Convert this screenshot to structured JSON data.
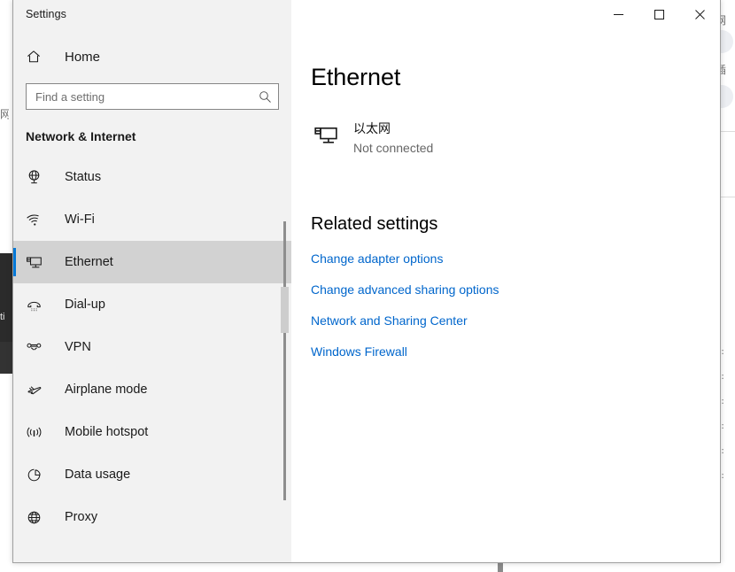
{
  "window": {
    "title": "Settings",
    "controls": {
      "minimize": "Minimize",
      "maximize": "Maximize",
      "close": "Close"
    }
  },
  "sidebar": {
    "home_label": "Home",
    "search": {
      "placeholder": "Find a setting",
      "value": "",
      "icon": "search-icon"
    },
    "category": "Network & Internet",
    "items": [
      {
        "label": "Status",
        "icon": "status-globe-icon",
        "selected": false
      },
      {
        "label": "Wi-Fi",
        "icon": "wifi-icon",
        "selected": false
      },
      {
        "label": "Ethernet",
        "icon": "ethernet-icon",
        "selected": true
      },
      {
        "label": "Dial-up",
        "icon": "dialup-phone-icon",
        "selected": false
      },
      {
        "label": "VPN",
        "icon": "vpn-icon",
        "selected": false
      },
      {
        "label": "Airplane mode",
        "icon": "airplane-icon",
        "selected": false
      },
      {
        "label": "Mobile hotspot",
        "icon": "hotspot-icon",
        "selected": false
      },
      {
        "label": "Data usage",
        "icon": "data-usage-pie-icon",
        "selected": false
      },
      {
        "label": "Proxy",
        "icon": "proxy-globe-icon",
        "selected": false
      }
    ]
  },
  "main": {
    "page_title": "Ethernet",
    "adapter": {
      "name": "以太网",
      "status": "Not connected",
      "icon": "ethernet-adapter-icon"
    },
    "related": {
      "title": "Related settings",
      "links": [
        "Change adapter options",
        "Change advanced sharing options",
        "Network and Sharing Center",
        "Windows Firewall"
      ]
    }
  },
  "background": {
    "taskbar_text": "ti",
    "edge_glyphs": [
      "网",
      "插"
    ],
    "edge_rows": [
      "h:",
      "h:",
      "h:",
      "h:",
      "h:",
      "h:"
    ]
  },
  "colors": {
    "accent": "#0078d7",
    "link": "#0066cc",
    "sidebar_bg": "#f2f2f2",
    "selected_row": "#d2d2d2",
    "close_hover": "#e81123"
  }
}
